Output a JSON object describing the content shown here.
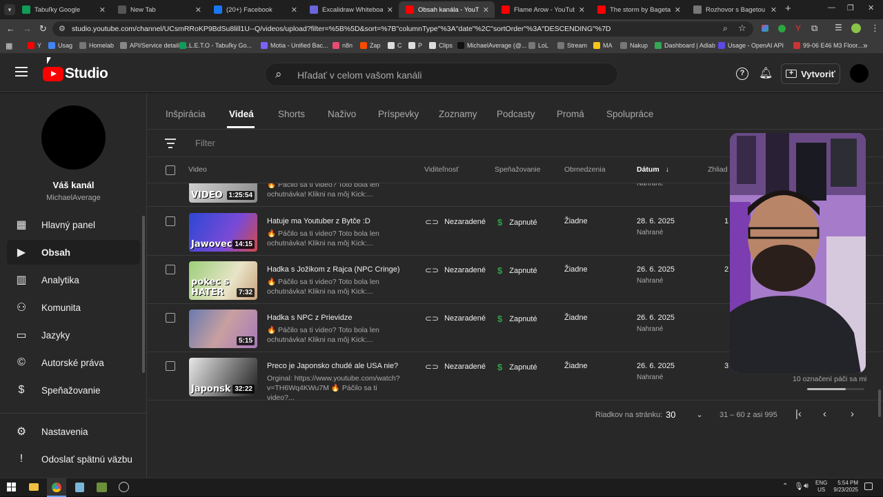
{
  "browser": {
    "tabs": [
      {
        "label": "Tabuľky Google",
        "color": "#0f9d58",
        "active": false
      },
      {
        "label": "New Tab",
        "color": "#555555",
        "active": false
      },
      {
        "label": "(20+) Facebook",
        "color": "#1877f2",
        "active": false
      },
      {
        "label": "Excalidraw Whiteboard",
        "color": "#6965db",
        "active": false
      },
      {
        "label": "Obsah kanála - YouTube S",
        "color": "#ff0000",
        "active": true
      },
      {
        "label": "Flame Arow - YouTube",
        "color": "#ff0000",
        "active": false
      },
      {
        "label": "The storm by Bageta - Yo",
        "color": "#ff0000",
        "active": false
      },
      {
        "label": "Rozhovor s Bagetou - GTA",
        "color": "#777777",
        "active": false
      }
    ],
    "url": "studio.youtube.com/channel/UCsmRRoKP9BdSu8lill1U--Q/videos/upload?filter=%5B%5D&sort=%7B\"columnType\"%3A\"date\"%2C\"sortOrder\"%3A\"DESCENDING\"%7D",
    "bookmarks": [
      {
        "label": "Y",
        "color": "#ff0000"
      },
      {
        "label": "Usag",
        "color": "#4285f4"
      },
      {
        "label": "Homelab",
        "color": "#777777"
      },
      {
        "label": "API/Service details -...",
        "color": "#888888"
      },
      {
        "label": "L.E.T.O - Tabuľky Go...",
        "color": "#0f9d58"
      },
      {
        "label": "Motia - Unified Bac...",
        "color": "#7b61ff"
      },
      {
        "label": "n8n",
        "color": "#ea4b71"
      },
      {
        "label": "Zap",
        "color": "#ff4a00"
      },
      {
        "label": "C",
        "color": "#dddddd"
      },
      {
        "label": "P",
        "color": "#dddddd"
      },
      {
        "label": "Clips",
        "color": "#dddddd"
      },
      {
        "label": "MichaelAverage (@...",
        "color": "#111111"
      },
      {
        "label": "LoL",
        "color": "#777777"
      },
      {
        "label": "Stream",
        "color": "#777777"
      },
      {
        "label": "MA",
        "color": "#f5c518"
      },
      {
        "label": "Nakup",
        "color": "#777777"
      },
      {
        "label": "Dashboard | Adlab",
        "color": "#34a853"
      },
      {
        "label": "Usage - OpenAI API",
        "color": "#5b4ae6"
      },
      {
        "label": "99-06 E46 M3 Floor...",
        "color": "#cc3333"
      }
    ]
  },
  "header": {
    "logo_text": "Studio",
    "search_placeholder": "Hľadať v celom vašom kanáli",
    "create_label": "Vytvoriť"
  },
  "sidebar": {
    "channel_name": "Váš kanál",
    "channel_handle": "MichaelAverage",
    "items": [
      {
        "label": "Hlavný panel",
        "icon": "dashboard-icon",
        "active": false
      },
      {
        "label": "Obsah",
        "icon": "content-icon",
        "active": true
      },
      {
        "label": "Analytika",
        "icon": "analytics-icon",
        "active": false
      },
      {
        "label": "Komunita",
        "icon": "community-icon",
        "active": false
      },
      {
        "label": "Jazyky",
        "icon": "subtitles-icon",
        "active": false
      },
      {
        "label": "Autorské práva",
        "icon": "copyright-icon",
        "active": false
      },
      {
        "label": "Speňažovanie",
        "icon": "dollar-icon",
        "active": false
      }
    ],
    "bottom_items": [
      {
        "label": "Nastavenia",
        "icon": "gear-icon"
      },
      {
        "label": "Odoslať spätnú väzbu",
        "icon": "feedback-icon"
      }
    ]
  },
  "main": {
    "tabs": [
      "Inšpirácia",
      "Videá",
      "Shorts",
      "Naživo",
      "Príspevky",
      "Zoznamy",
      "Podcasty",
      "Promá",
      "Spolupráce"
    ],
    "active_tab": "Videá",
    "filter_placeholder": "Filter",
    "columns": {
      "video": "Video",
      "visibility": "Viditeľnosť",
      "monetization": "Speňažovanie",
      "restrictions": "Obmedzenia",
      "date": "Dátum",
      "views": "Zhliad"
    },
    "rows": [
      {
        "title": "",
        "desc": "🔥 Páčilo sa ti video? Toto bola len ochutnávka! Klikni na môj Kick:...",
        "duration": "1:25:54",
        "thumb_text": "VIDEO",
        "visibility": "",
        "monetization": "",
        "restrictions": "",
        "date": "",
        "date_sub": "Nahrané",
        "views": ""
      },
      {
        "title": "Hatuje ma Youtuber z Bytče :D",
        "desc": "🔥 Páčilo sa ti video? Toto bola len ochutnávka! Klikni na môj Kick:...",
        "duration": "14:15",
        "thumb_text": "Jawovec",
        "visibility": "Nezaradené",
        "monetization": "Zapnuté",
        "restrictions": "Žiadne",
        "date": "28. 6. 2025",
        "date_sub": "Nahrané",
        "views": "1"
      },
      {
        "title": "Hadka s Jožikom z Rajca (NPC Cringe)",
        "desc": "🔥 Páčilo sa ti video? Toto bola len ochutnávka! Klikni na môj Kick:...",
        "duration": "7:32",
        "thumb_text": "pokec s HATER",
        "visibility": "Nezaradené",
        "monetization": "Zapnuté",
        "restrictions": "Žiadne",
        "date": "26. 6. 2025",
        "date_sub": "Nahrané",
        "views": "2"
      },
      {
        "title": "Hadka s NPC z Prievidze",
        "desc": "🔥 Páčilo sa ti video? Toto bola len ochutnávka! Klikni na môj Kick:...",
        "duration": "5:15",
        "thumb_text": "",
        "visibility": "Nezaradené",
        "monetization": "Zapnuté",
        "restrictions": "Žiadne",
        "date": "26. 6. 2025",
        "date_sub": "Nahrané",
        "views": ""
      },
      {
        "title": "Preco je Japonsko chudé ale USA nie?",
        "desc": "Orginal: https://www.youtube.com/watch?v=TH6Wq4KWu7M 🔥 Páčilo sa ti video?...",
        "duration": "32:22",
        "thumb_text": "Japonsk",
        "visibility": "Nezaradené",
        "monetization": "Zapnuté",
        "restrictions": "Žiadne",
        "date": "26. 6. 2025",
        "date_sub": "Nahrané",
        "views": "3"
      }
    ],
    "likes_note": "10 označení páči sa mi",
    "pagination": {
      "rows_per_page_label": "Riadkov na stránku:",
      "rows_per_page_value": "30",
      "range": "31 – 60 z asi 995"
    }
  },
  "taskbar": {
    "lang": "ENG",
    "region": "US",
    "time": "5:54 PM",
    "date": "9/23/2025"
  },
  "colors": {
    "accent_red": "#ff0000",
    "money_green": "#2ba640",
    "bg_dark": "#282828"
  }
}
